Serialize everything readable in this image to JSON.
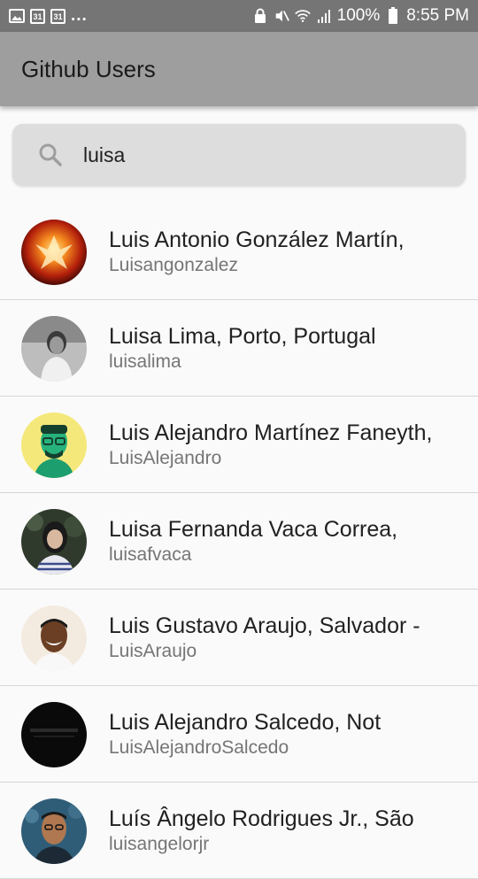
{
  "status_bar": {
    "left_icons": [
      "image-icon",
      "calendar-icon",
      "calendar-icon"
    ],
    "calendar_day": "31",
    "more": "...",
    "battery": "100%",
    "time": "8:55 PM"
  },
  "app_bar": {
    "title": "Github Users"
  },
  "search": {
    "value": "luisa",
    "icon": "search-icon"
  },
  "users": [
    {
      "name": "Luis Antonio González Martín,",
      "login": "Luisangonzalez"
    },
    {
      "name": "Luisa Lima, Porto, Portugal",
      "login": "luisalima"
    },
    {
      "name": "Luis Alejandro Martínez Faneyth,",
      "login": "LuisAlejandro"
    },
    {
      "name": "Luisa Fernanda Vaca Correa,",
      "login": "luisafvaca"
    },
    {
      "name": "Luis Gustavo Araujo, Salvador -",
      "login": "LuisAraujo"
    },
    {
      "name": "Luis Alejandro Salcedo, Not",
      "login": "LuisAlejandroSalcedo"
    },
    {
      "name": "Luís Ângelo Rodrigues Jr., São",
      "login": "luisangelorjr"
    }
  ]
}
